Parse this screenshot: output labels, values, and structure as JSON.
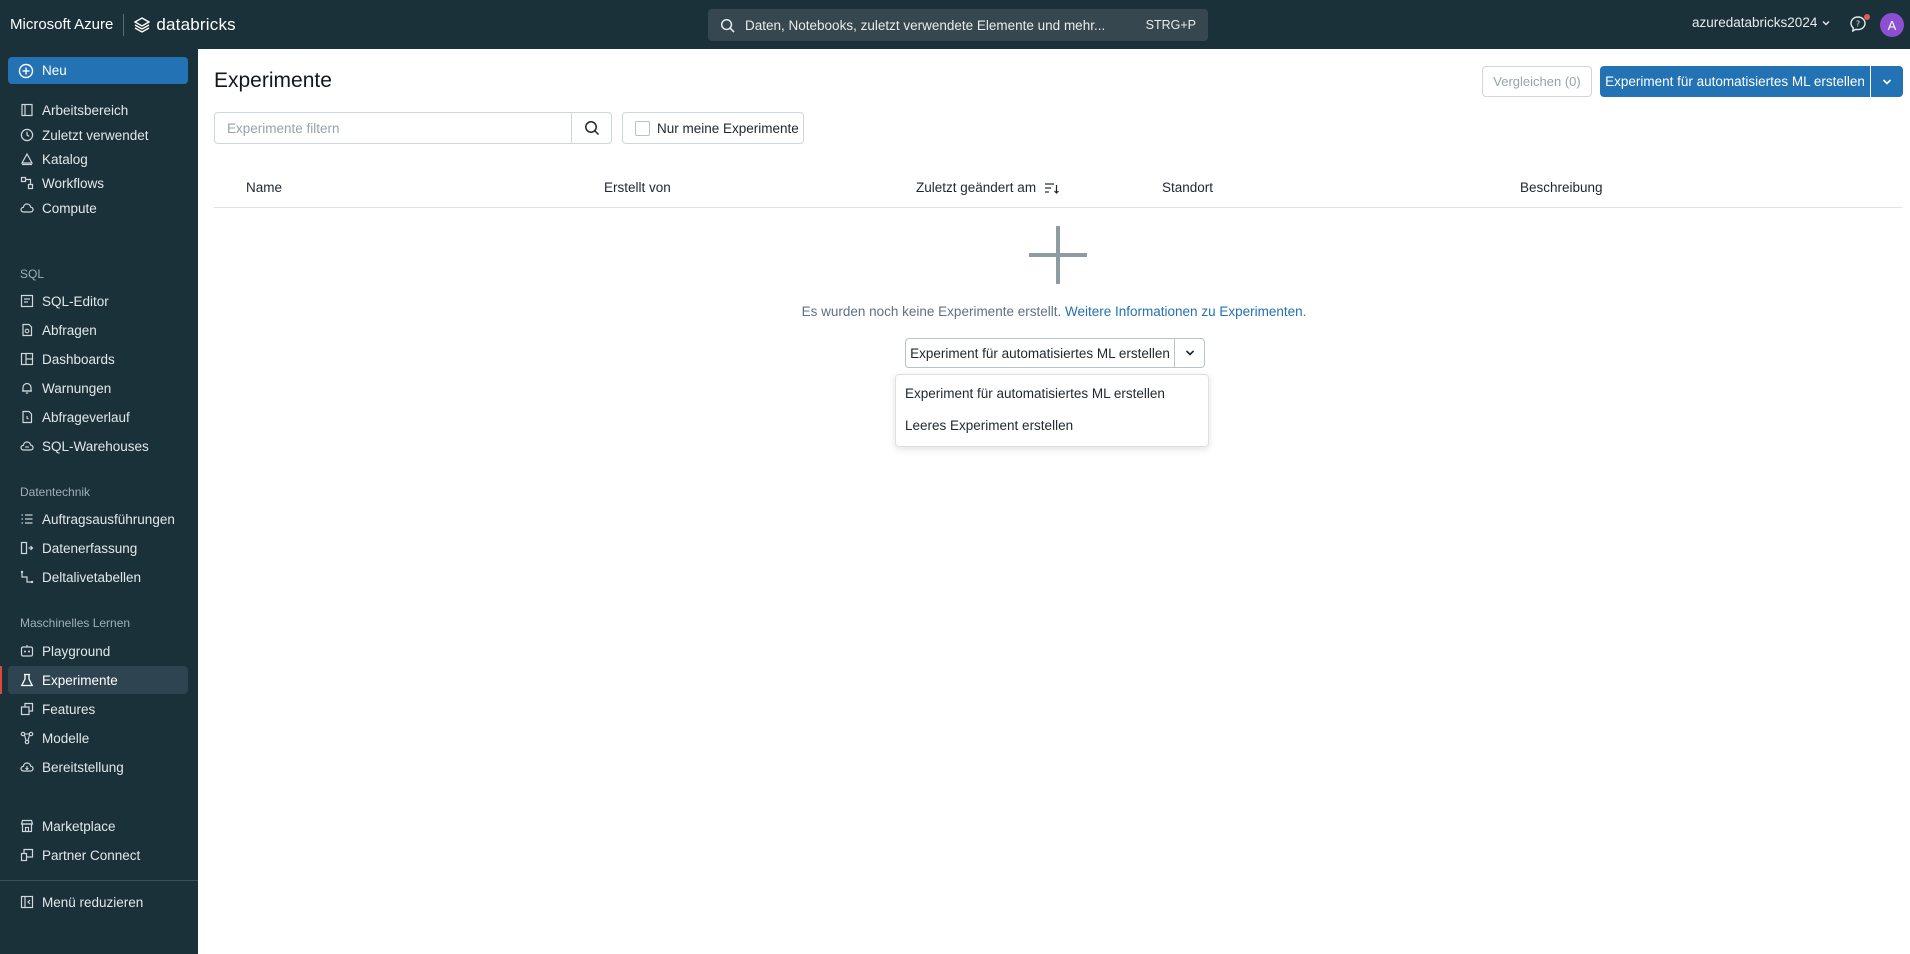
{
  "topbar": {
    "microsoft_label": "Microsoft Azure",
    "databricks_label": "databricks",
    "search_placeholder": "Daten, Notebooks, zuletzt verwendete Elemente und mehr...",
    "search_shortcut": "STRG+P",
    "workspace_name": "azuredatabricks2024",
    "avatar_initial": "A"
  },
  "sidebar": {
    "new_label": "Neu",
    "items_main": [
      {
        "label": "Arbeitsbereich",
        "icon": "workspace-icon"
      },
      {
        "label": "Zuletzt verwendet",
        "icon": "clock-icon"
      },
      {
        "label": "Katalog",
        "icon": "catalog-icon"
      },
      {
        "label": "Workflows",
        "icon": "workflows-icon"
      },
      {
        "label": "Compute",
        "icon": "cloud-icon"
      }
    ],
    "section_sql": "SQL",
    "items_sql": [
      {
        "label": "SQL-Editor",
        "icon": "editor-icon"
      },
      {
        "label": "Abfragen",
        "icon": "query-icon"
      },
      {
        "label": "Dashboards",
        "icon": "dashboard-icon"
      },
      {
        "label": "Warnungen",
        "icon": "bell-icon"
      },
      {
        "label": "Abfrageverlauf",
        "icon": "history-icon"
      },
      {
        "label": "SQL-Warehouses",
        "icon": "warehouse-icon"
      }
    ],
    "section_data": "Datentechnik",
    "items_data": [
      {
        "label": "Auftragsausführungen",
        "icon": "job-runs-icon"
      },
      {
        "label": "Datenerfassung",
        "icon": "ingestion-icon"
      },
      {
        "label": "Deltalivetabellen",
        "icon": "pipeline-icon"
      }
    ],
    "section_ml": "Maschinelles Lernen",
    "items_ml": [
      {
        "label": "Playground",
        "icon": "playground-icon"
      },
      {
        "label": "Experimente",
        "icon": "flask-icon",
        "active": true
      },
      {
        "label": "Features",
        "icon": "features-icon"
      },
      {
        "label": "Modelle",
        "icon": "models-icon"
      },
      {
        "label": "Bereitstellung",
        "icon": "serving-icon"
      }
    ],
    "items_bottom": [
      {
        "label": "Marketplace",
        "icon": "store-icon"
      },
      {
        "label": "Partner Connect",
        "icon": "partner-icon"
      }
    ],
    "collapse_label": "Menü reduzieren"
  },
  "main": {
    "title": "Experimente",
    "compare_label": "Vergleichen (0)",
    "create_automl_label": "Experiment für automatisiertes ML erstellen",
    "filter_placeholder": "Experimente filtern",
    "only_mine_label": "Nur meine Experimente",
    "columns": [
      "Name",
      "Erstellt von",
      "Zuletzt geändert am",
      "Standort",
      "Beschreibung"
    ],
    "empty_text": "Es wurden noch keine Experimente erstellt.",
    "empty_link": "Weitere Informationen zu Experimenten",
    "empty_link_suffix": ".",
    "empty_create_label": "Experiment für automatisiertes ML erstellen",
    "dropdown_items": [
      "Experiment für automatisiertes ML erstellen",
      "Leeres Experiment erstellen"
    ]
  },
  "colors": {
    "sidebar_bg": "#1b3139",
    "accent": "#2272b4",
    "active_marker": "#e0483f"
  }
}
